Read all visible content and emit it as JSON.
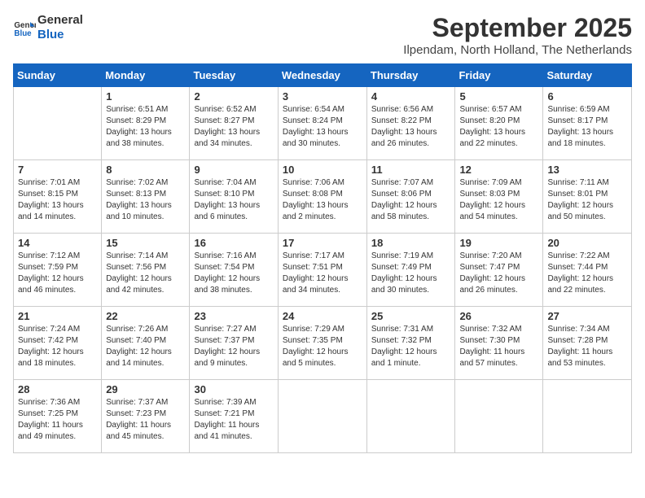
{
  "logo": {
    "line1": "General",
    "line2": "Blue"
  },
  "title": "September 2025",
  "subtitle": "Ilpendam, North Holland, The Netherlands",
  "days_header": [
    "Sunday",
    "Monday",
    "Tuesday",
    "Wednesday",
    "Thursday",
    "Friday",
    "Saturday"
  ],
  "weeks": [
    [
      {
        "day": "",
        "info": ""
      },
      {
        "day": "1",
        "info": "Sunrise: 6:51 AM\nSunset: 8:29 PM\nDaylight: 13 hours\nand 38 minutes."
      },
      {
        "day": "2",
        "info": "Sunrise: 6:52 AM\nSunset: 8:27 PM\nDaylight: 13 hours\nand 34 minutes."
      },
      {
        "day": "3",
        "info": "Sunrise: 6:54 AM\nSunset: 8:24 PM\nDaylight: 13 hours\nand 30 minutes."
      },
      {
        "day": "4",
        "info": "Sunrise: 6:56 AM\nSunset: 8:22 PM\nDaylight: 13 hours\nand 26 minutes."
      },
      {
        "day": "5",
        "info": "Sunrise: 6:57 AM\nSunset: 8:20 PM\nDaylight: 13 hours\nand 22 minutes."
      },
      {
        "day": "6",
        "info": "Sunrise: 6:59 AM\nSunset: 8:17 PM\nDaylight: 13 hours\nand 18 minutes."
      }
    ],
    [
      {
        "day": "7",
        "info": "Sunrise: 7:01 AM\nSunset: 8:15 PM\nDaylight: 13 hours\nand 14 minutes."
      },
      {
        "day": "8",
        "info": "Sunrise: 7:02 AM\nSunset: 8:13 PM\nDaylight: 13 hours\nand 10 minutes."
      },
      {
        "day": "9",
        "info": "Sunrise: 7:04 AM\nSunset: 8:10 PM\nDaylight: 13 hours\nand 6 minutes."
      },
      {
        "day": "10",
        "info": "Sunrise: 7:06 AM\nSunset: 8:08 PM\nDaylight: 13 hours\nand 2 minutes."
      },
      {
        "day": "11",
        "info": "Sunrise: 7:07 AM\nSunset: 8:06 PM\nDaylight: 12 hours\nand 58 minutes."
      },
      {
        "day": "12",
        "info": "Sunrise: 7:09 AM\nSunset: 8:03 PM\nDaylight: 12 hours\nand 54 minutes."
      },
      {
        "day": "13",
        "info": "Sunrise: 7:11 AM\nSunset: 8:01 PM\nDaylight: 12 hours\nand 50 minutes."
      }
    ],
    [
      {
        "day": "14",
        "info": "Sunrise: 7:12 AM\nSunset: 7:59 PM\nDaylight: 12 hours\nand 46 minutes."
      },
      {
        "day": "15",
        "info": "Sunrise: 7:14 AM\nSunset: 7:56 PM\nDaylight: 12 hours\nand 42 minutes."
      },
      {
        "day": "16",
        "info": "Sunrise: 7:16 AM\nSunset: 7:54 PM\nDaylight: 12 hours\nand 38 minutes."
      },
      {
        "day": "17",
        "info": "Sunrise: 7:17 AM\nSunset: 7:51 PM\nDaylight: 12 hours\nand 34 minutes."
      },
      {
        "day": "18",
        "info": "Sunrise: 7:19 AM\nSunset: 7:49 PM\nDaylight: 12 hours\nand 30 minutes."
      },
      {
        "day": "19",
        "info": "Sunrise: 7:20 AM\nSunset: 7:47 PM\nDaylight: 12 hours\nand 26 minutes."
      },
      {
        "day": "20",
        "info": "Sunrise: 7:22 AM\nSunset: 7:44 PM\nDaylight: 12 hours\nand 22 minutes."
      }
    ],
    [
      {
        "day": "21",
        "info": "Sunrise: 7:24 AM\nSunset: 7:42 PM\nDaylight: 12 hours\nand 18 minutes."
      },
      {
        "day": "22",
        "info": "Sunrise: 7:26 AM\nSunset: 7:40 PM\nDaylight: 12 hours\nand 14 minutes."
      },
      {
        "day": "23",
        "info": "Sunrise: 7:27 AM\nSunset: 7:37 PM\nDaylight: 12 hours\nand 9 minutes."
      },
      {
        "day": "24",
        "info": "Sunrise: 7:29 AM\nSunset: 7:35 PM\nDaylight: 12 hours\nand 5 minutes."
      },
      {
        "day": "25",
        "info": "Sunrise: 7:31 AM\nSunset: 7:32 PM\nDaylight: 12 hours\nand 1 minute."
      },
      {
        "day": "26",
        "info": "Sunrise: 7:32 AM\nSunset: 7:30 PM\nDaylight: 11 hours\nand 57 minutes."
      },
      {
        "day": "27",
        "info": "Sunrise: 7:34 AM\nSunset: 7:28 PM\nDaylight: 11 hours\nand 53 minutes."
      }
    ],
    [
      {
        "day": "28",
        "info": "Sunrise: 7:36 AM\nSunset: 7:25 PM\nDaylight: 11 hours\nand 49 minutes."
      },
      {
        "day": "29",
        "info": "Sunrise: 7:37 AM\nSunset: 7:23 PM\nDaylight: 11 hours\nand 45 minutes."
      },
      {
        "day": "30",
        "info": "Sunrise: 7:39 AM\nSunset: 7:21 PM\nDaylight: 11 hours\nand 41 minutes."
      },
      {
        "day": "",
        "info": ""
      },
      {
        "day": "",
        "info": ""
      },
      {
        "day": "",
        "info": ""
      },
      {
        "day": "",
        "info": ""
      }
    ]
  ]
}
